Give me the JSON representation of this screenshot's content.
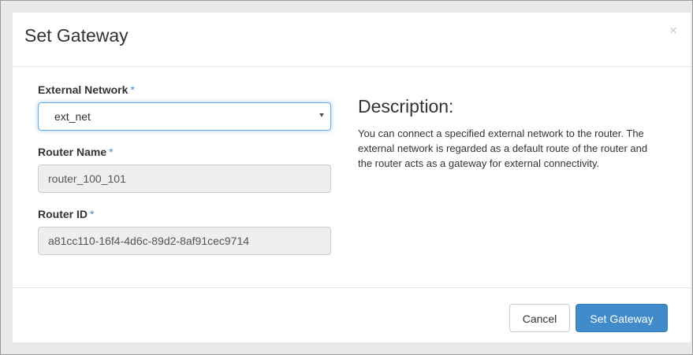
{
  "dialog": {
    "title": "Set Gateway",
    "close_glyph": "×"
  },
  "form": {
    "external_network": {
      "label": "External Network",
      "required_mark": "*",
      "selected_value": "ext_net"
    },
    "router_name": {
      "label": "Router Name",
      "required_mark": "*",
      "value": "router_100_101"
    },
    "router_id": {
      "label": "Router ID",
      "required_mark": "*",
      "value": "a81cc110-16f4-4d6c-89d2-8af91cec9714"
    }
  },
  "description": {
    "heading": "Description:",
    "text": "You can connect a specified external network to the router. The external network is regarded as a default route of the router and the router acts as a gateway for external connectivity."
  },
  "footer": {
    "cancel_label": "Cancel",
    "submit_label": "Set Gateway"
  },
  "colors": {
    "primary": "#428bca",
    "required_mark": "#4a8ccc",
    "focus_border": "#66afe9"
  }
}
